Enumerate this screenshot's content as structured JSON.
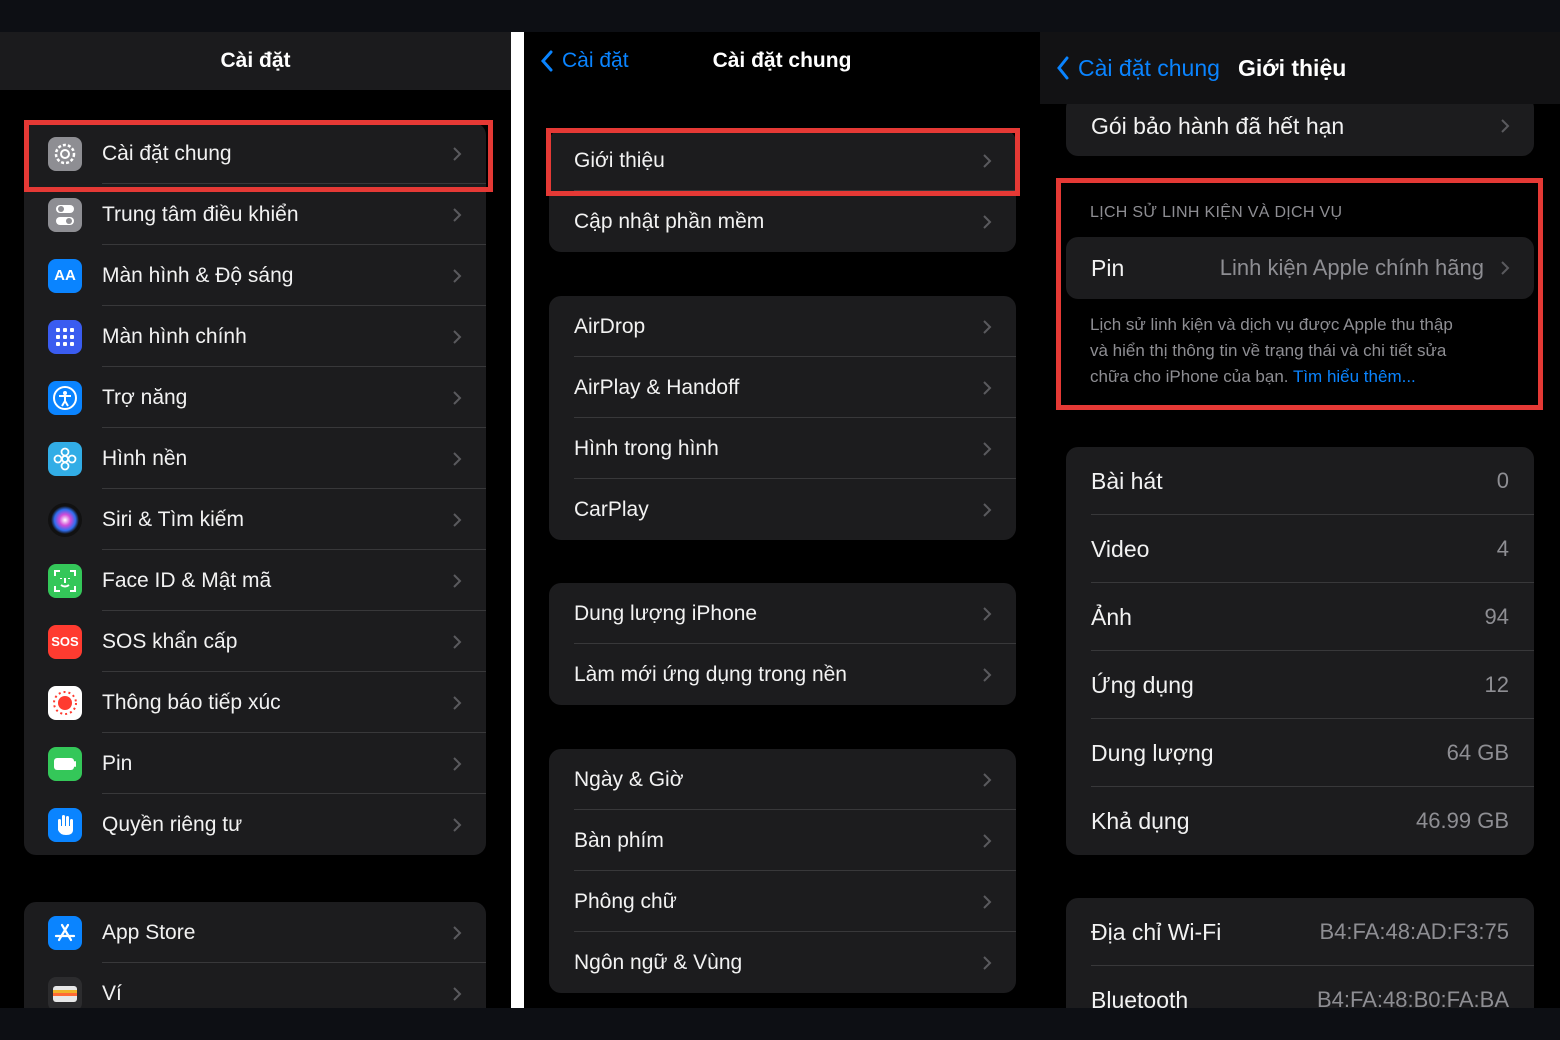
{
  "colors": {
    "accent": "#0a84ff",
    "highlight": "#e53935",
    "background": "#000000",
    "cell": "#1c1c1e"
  },
  "settings": {
    "title": "Cài đặt",
    "group1": [
      {
        "label": "Cài đặt chung",
        "icon": "gear-icon",
        "color": "#8e8e93"
      },
      {
        "label": "Trung tâm điều khiển",
        "icon": "toggles-icon",
        "color": "#8e8e93"
      },
      {
        "label": "Màn hình & Độ sáng",
        "icon": "text-size-icon",
        "color": "#0a84ff"
      },
      {
        "label": "Màn hình chính",
        "icon": "home-grid-icon",
        "color": "#3a5cf0"
      },
      {
        "label": "Trợ năng",
        "icon": "accessibility-icon",
        "color": "#0a84ff"
      },
      {
        "label": "Hình nền",
        "icon": "flower-icon",
        "color": "#32ade6"
      },
      {
        "label": "Siri & Tìm kiếm",
        "icon": "siri-icon",
        "color": "#1c1c1e"
      },
      {
        "label": "Face ID & Mật mã",
        "icon": "face-id-icon",
        "color": "#34c759"
      },
      {
        "label": "SOS khẩn cấp",
        "icon": "sos-icon",
        "color": "#ff3b30"
      },
      {
        "label": "Thông báo tiếp xúc",
        "icon": "exposure-icon",
        "color": "#ffffff"
      },
      {
        "label": "Pin",
        "icon": "battery-icon",
        "color": "#34c759"
      },
      {
        "label": "Quyền riêng tư",
        "icon": "hand-icon",
        "color": "#0a84ff"
      }
    ],
    "group2": [
      {
        "label": "App Store",
        "icon": "app-store-icon",
        "color": "#0a84ff"
      },
      {
        "label": "Ví",
        "icon": "wallet-icon",
        "color": "#1c1c1e"
      }
    ],
    "sos_icon_text": "SOS"
  },
  "general": {
    "back_label": "Cài đặt",
    "title": "Cài đặt chung",
    "groups": [
      [
        "Giới thiệu",
        "Cập nhật phần mềm"
      ],
      [
        "AirDrop",
        "AirPlay & Handoff",
        "Hình trong hình",
        "CarPlay"
      ],
      [
        "Dung lượng iPhone",
        "Làm mới ứng dụng trong nền"
      ],
      [
        "Ngày & Giờ",
        "Bàn phím",
        "Phông chữ",
        "Ngôn ngữ & Vùng"
      ]
    ]
  },
  "about": {
    "back_label": "Cài đặt chung",
    "title": "Giới thiệu",
    "warranty_label": "Gói bảo hành đã hết hạn",
    "history_header": "LỊCH SỬ LINH KIỆN VÀ DỊCH VỤ",
    "battery_label": "Pin",
    "battery_value": "Linh kiện Apple chính hãng",
    "footer_line1": "Lịch sử linh kiện và dịch vụ được Apple thu thập",
    "footer_line2": "và hiển thị thông tin về trạng thái và chi tiết sửa",
    "footer_line3": "chữa cho iPhone của bạn.",
    "footer_link": "Tìm hiểu thêm...",
    "stats": [
      {
        "label": "Bài hát",
        "value": "0"
      },
      {
        "label": "Video",
        "value": "4"
      },
      {
        "label": "Ảnh",
        "value": "94"
      },
      {
        "label": "Ứng dụng",
        "value": "12"
      },
      {
        "label": "Dung lượng",
        "value": "64 GB"
      },
      {
        "label": "Khả dụng",
        "value": "46.99 GB"
      }
    ],
    "network": [
      {
        "label": "Địa chỉ Wi-Fi",
        "value": "B4:FA:48:AD:F3:75"
      },
      {
        "label": "Bluetooth",
        "value": "B4:FA:48:B0:FA:BA"
      }
    ]
  }
}
